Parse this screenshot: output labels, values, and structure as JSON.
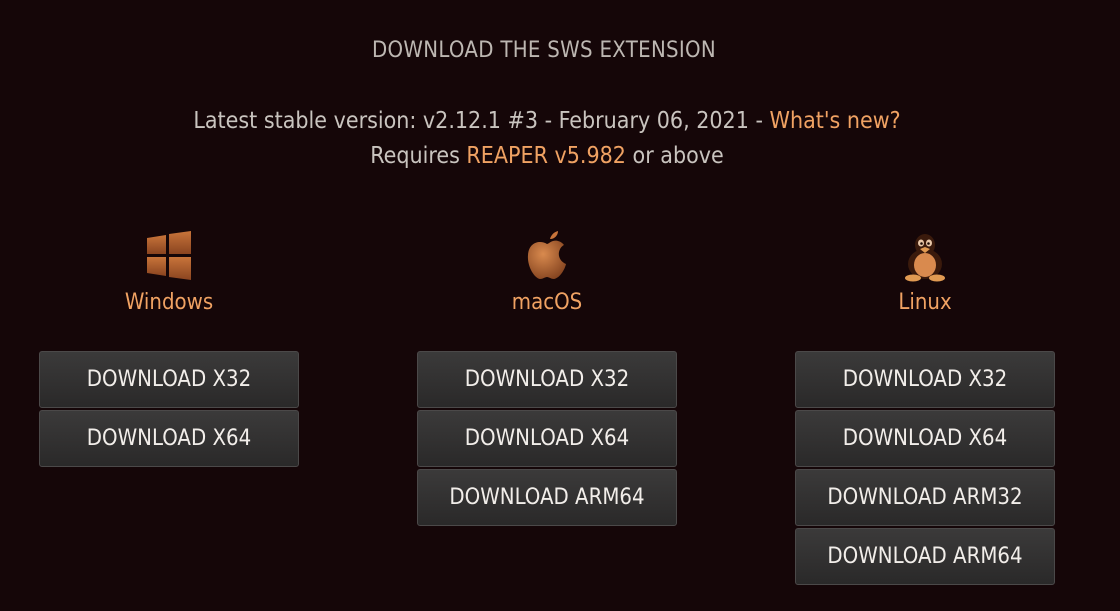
{
  "page": {
    "heading": "DOWNLOAD THE SWS EXTENSION",
    "version_prefix": "Latest stable version: v2.12.1 #3 - February 06, 2021 - ",
    "whats_new_link": "What's new?",
    "requires_prefix": "Requires ",
    "reaper_link": "REAPER v5.982",
    "requires_suffix": " or above"
  },
  "colors": {
    "background": "#150608",
    "accent": "#f0a263",
    "text": "#c9c4bf",
    "button": "#333232"
  },
  "platforms": {
    "windows": {
      "name": "Windows",
      "icon": "windows-logo-icon",
      "buttons": [
        "DOWNLOAD X32",
        "DOWNLOAD X64"
      ]
    },
    "macos": {
      "name": "macOS",
      "icon": "apple-logo-icon",
      "buttons": [
        "DOWNLOAD X32",
        "DOWNLOAD X64",
        "DOWNLOAD ARM64"
      ]
    },
    "linux": {
      "name": "Linux",
      "icon": "tux-penguin-icon",
      "buttons": [
        "DOWNLOAD X32",
        "DOWNLOAD X64",
        "DOWNLOAD ARM32",
        "DOWNLOAD ARM64"
      ]
    }
  }
}
